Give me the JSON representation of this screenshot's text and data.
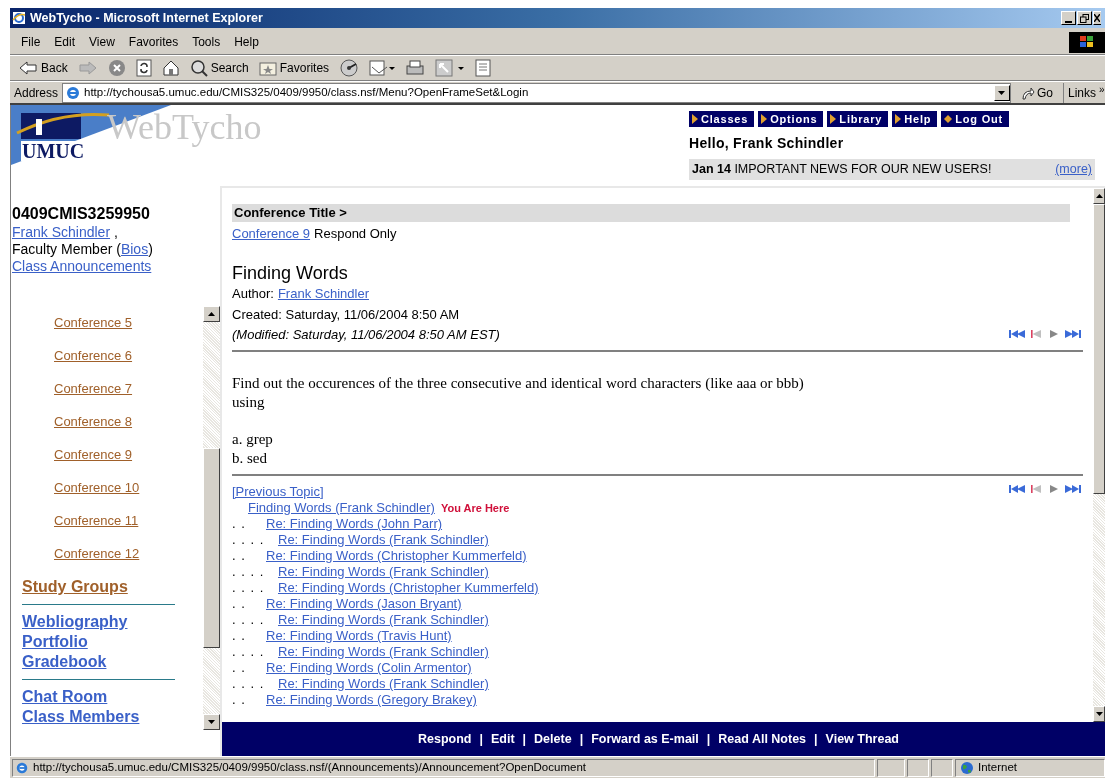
{
  "window": {
    "title": "WebTycho - Microsoft Internet Explorer"
  },
  "menu": [
    "File",
    "Edit",
    "View",
    "Favorites",
    "Tools",
    "Help"
  ],
  "toolbar": [
    {
      "kind": "back",
      "label": "Back"
    },
    {
      "kind": "forward"
    },
    {
      "kind": "stop"
    },
    {
      "kind": "refresh"
    },
    {
      "kind": "home"
    },
    {
      "kind": "search",
      "label": "Search"
    },
    {
      "kind": "favorites",
      "label": "Favorites"
    },
    {
      "kind": "media"
    },
    {
      "kind": "mail"
    },
    {
      "kind": "print"
    },
    {
      "kind": "edit"
    },
    {
      "kind": "discuss"
    }
  ],
  "address": {
    "label": "Address",
    "value": "http://tychousa5.umuc.edu/CMIS325/0409/9950/class.nsf/Menu?OpenFrameSet&Login",
    "go": "Go",
    "links": "Links",
    "links_more": "»"
  },
  "site": {
    "logo_text": "UMUC",
    "brand": "WebTycho"
  },
  "nav": [
    {
      "label": "Classes",
      "kind": "arrow"
    },
    {
      "label": "Options",
      "kind": "arrow"
    },
    {
      "label": "Library",
      "kind": "arrow"
    },
    {
      "label": "Help",
      "kind": "arrow"
    },
    {
      "label": "Log Out",
      "kind": "diamond"
    }
  ],
  "greeting": "Hello, Frank Schindler",
  "news": {
    "date": "Jan 14",
    "headline": "IMPORTANT NEWS FOR OUR NEW USERS!",
    "more": "(more)"
  },
  "sidebar": {
    "course": "0409CMIS3259950",
    "instructor": "Frank Schindler",
    "instructor_sep": ",",
    "role": "Faculty Member (",
    "bios": "Bios",
    "role_end": ")",
    "announcements": "Class Announcements",
    "items": [
      {
        "kind": "conference",
        "label": "Conference 5"
      },
      {
        "kind": "conference",
        "label": "Conference 6"
      },
      {
        "kind": "conference",
        "label": "Conference 7"
      },
      {
        "kind": "conference",
        "label": "Conference 8"
      },
      {
        "kind": "conference",
        "label": "Conference 9"
      },
      {
        "kind": "conference",
        "label": "Conference 10"
      },
      {
        "kind": "conference",
        "label": "Conference 11"
      },
      {
        "kind": "conference",
        "label": "Conference 12"
      },
      {
        "kind": "group",
        "label": "Study Groups"
      },
      {
        "kind": "rule"
      },
      {
        "kind": "tool",
        "label": "Webliography"
      },
      {
        "kind": "tool",
        "label": "Portfolio"
      },
      {
        "kind": "tool",
        "label": "Gradebook"
      },
      {
        "kind": "rule"
      },
      {
        "kind": "tool",
        "label": "Chat Room"
      },
      {
        "kind": "tool",
        "label": "Class Members"
      }
    ]
  },
  "post": {
    "breadcrumb": "Conference Title >",
    "conference": "Conference 9",
    "access": "Respond Only",
    "title": "Finding Words",
    "author_label": "Author:",
    "author": "Frank Schindler",
    "created": "Created: Saturday, 11/06/2004 8:50 AM",
    "modified": "(Modified: Saturday, 11/06/2004 8:50 AM EST)",
    "body": [
      {
        "lines": [
          "Find out the occurences of the three consecutive and identical word characters (like aaa or bbb)",
          "using"
        ]
      },
      {
        "lines": [
          "a. grep",
          "b. sed"
        ]
      }
    ]
  },
  "thread": {
    "previous": "[Previous Topic]",
    "here": "You Are Here",
    "root": {
      "title": "Finding Words (Frank Schindler)",
      "children": [
        {
          "marker": ". .",
          "title": "Re: Finding Words (John Parr)",
          "children": [
            {
              "marker": ". . . .",
              "title": "Re: Finding Words (Frank Schindler)"
            }
          ]
        },
        {
          "marker": ". .",
          "title": "Re: Finding Words (Christopher Kummerfeld)",
          "children": [
            {
              "marker": ". . . .",
              "title": "Re: Finding Words (Frank Schindler)"
            },
            {
              "marker": ". . . .",
              "title": "Re: Finding Words (Christopher Kummerfeld)"
            }
          ]
        },
        {
          "marker": ". .",
          "title": "Re: Finding Words (Jason Bryant)",
          "children": [
            {
              "marker": ". . . .",
              "title": "Re: Finding Words (Frank Schindler)"
            }
          ]
        },
        {
          "marker": ". .",
          "title": "Re: Finding Words (Travis Hunt)",
          "children": [
            {
              "marker": ". . . .",
              "title": "Re: Finding Words (Frank Schindler)"
            }
          ]
        },
        {
          "marker": ". .",
          "title": "Re: Finding Words (Colin Armentor)",
          "children": [
            {
              "marker": ". . . .",
              "title": "Re: Finding Words (Frank Schindler)"
            }
          ]
        },
        {
          "marker": ". .",
          "title": "Re: Finding Words (Gregory Brakey)"
        }
      ]
    }
  },
  "action_separator": "|",
  "actions": [
    "Respond",
    "Edit",
    "Delete",
    "Forward as E-mail",
    "Read All Notes",
    "View Thread"
  ],
  "status_bar": {
    "url": "http://tychousa5.umuc.edu/CMIS325/0409/9950/class.nsf/(Announcements)/Announcement?OpenDocument",
    "zone": "Internet"
  }
}
